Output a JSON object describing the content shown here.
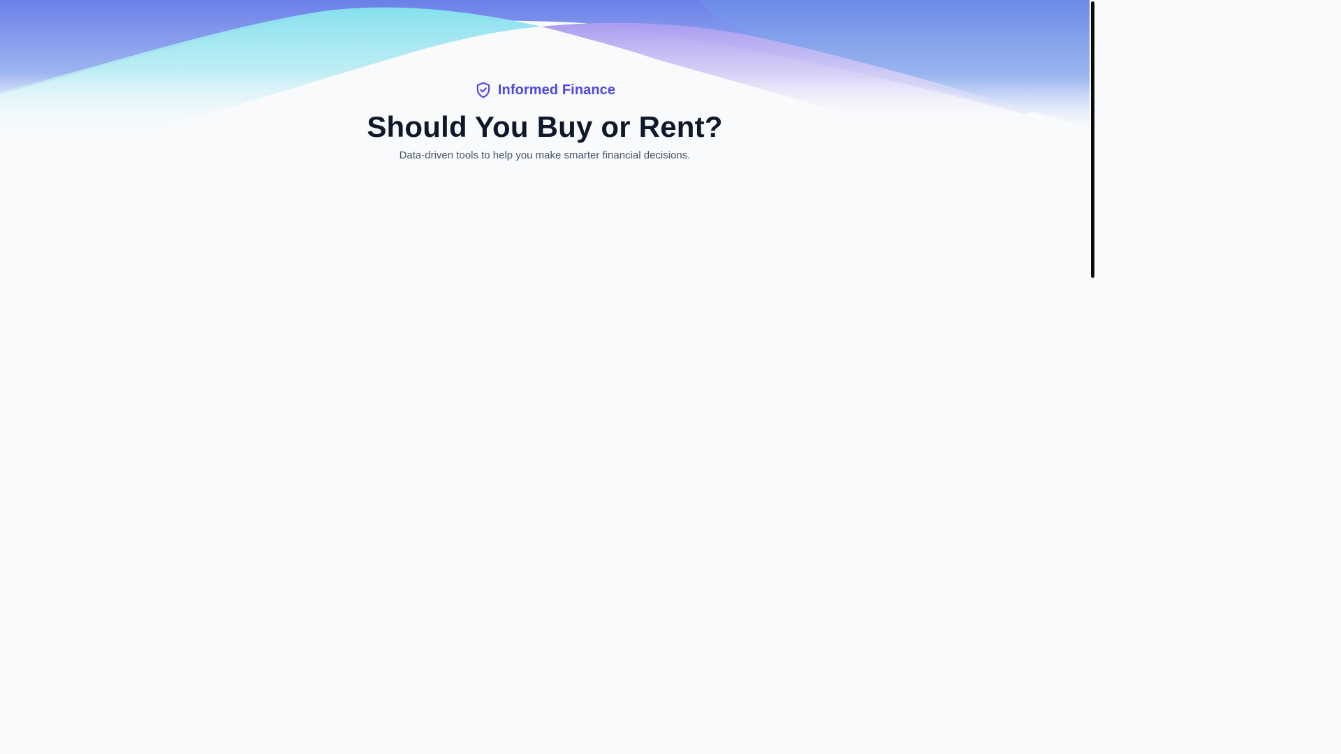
{
  "brand": {
    "name": "Informed Finance",
    "icon": "shield-check-icon",
    "color": "#4f46e5"
  },
  "hero": {
    "title": "Should You Buy or Rent?",
    "subtitle": "Data-driven tools to help you make smarter financial decisions."
  },
  "theme": {
    "background": "#f8fafc",
    "title_color": "#0f172a",
    "subtitle_color": "#475569",
    "wave_blue": "#6366f1",
    "wave_cyan": "#67e8f9",
    "wave_lavender": "#a78bfa"
  }
}
